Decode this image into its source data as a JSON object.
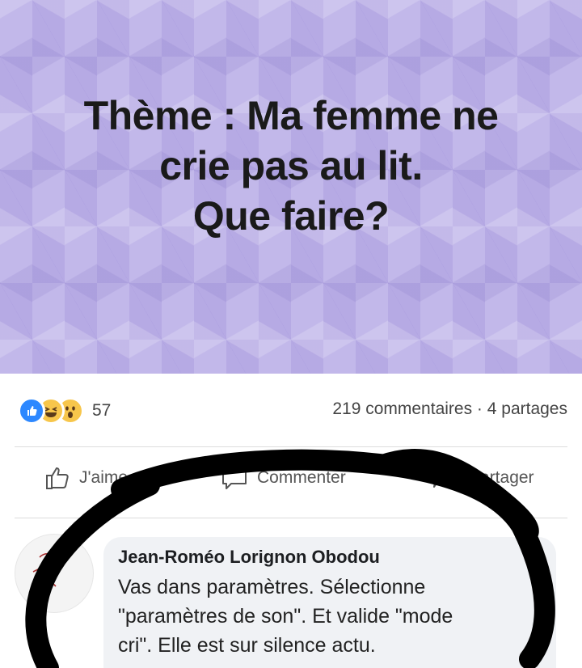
{
  "banner": {
    "lines": [
      "Thème : Ma femme ne",
      "crie pas au lit.",
      "Que faire?"
    ]
  },
  "stats": {
    "reactions": [
      "like-icon",
      "haha-icon",
      "wow-icon"
    ],
    "reaction_count": "57",
    "comments_shares": "219 commentaires · 4 partages"
  },
  "actions": {
    "like_label": "J'aime",
    "comment_label": "Commenter",
    "share_label": "Partager"
  },
  "comment": {
    "author": "Jean-Roméo Lorignon Obodou",
    "lines": [
      "Vas dans paramètres. Sélectionne",
      "\"paramètres de son\". Et valide \"mode",
      "cri\". Elle est sur silence actu."
    ]
  },
  "colors": {
    "banner_bg": "#c2b8ea",
    "like_blue": "#2d88ff",
    "emoji_yellow": "#f7c64b",
    "scribble": "#000000"
  }
}
